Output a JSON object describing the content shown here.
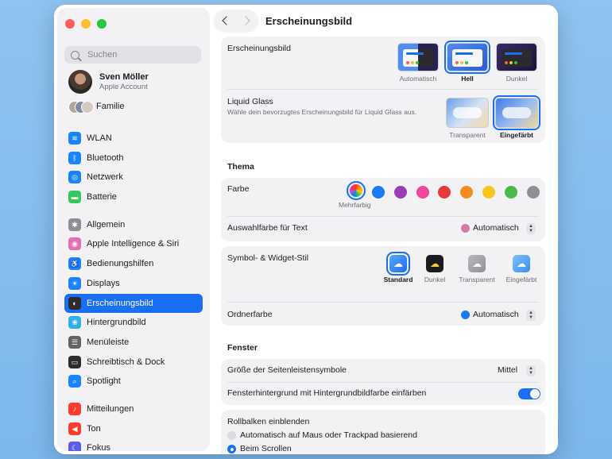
{
  "search": {
    "placeholder": "Suchen"
  },
  "account": {
    "name": "Sven Möller",
    "subtitle": "Apple Account"
  },
  "family": {
    "label": "Familie"
  },
  "sidebar": {
    "items": [
      {
        "label": "WLAN",
        "icon": "wifi-icon",
        "color": "#1a84ff"
      },
      {
        "label": "Bluetooth",
        "icon": "bluetooth-icon",
        "color": "#1a84ff"
      },
      {
        "label": "Netzwerk",
        "icon": "globe-icon",
        "color": "#1a84ff"
      },
      {
        "label": "Batterie",
        "icon": "battery-icon",
        "color": "#34c759"
      },
      {
        "label": "Allgemein",
        "icon": "gear-icon",
        "color": "#8e8e93"
      },
      {
        "label": "Apple Intelligence & Siri",
        "icon": "siri-icon",
        "color": "#e36fb0"
      },
      {
        "label": "Bedienungshilfen",
        "icon": "accessibility-icon",
        "color": "#1a84ff"
      },
      {
        "label": "Displays",
        "icon": "sun-icon",
        "color": "#1a84ff"
      },
      {
        "label": "Erscheinungsbild",
        "icon": "appearance-icon",
        "color": "#2c2c2e"
      },
      {
        "label": "Hintergrundbild",
        "icon": "flower-icon",
        "color": "#30b0e8"
      },
      {
        "label": "Menüleiste",
        "icon": "menubar-icon",
        "color": "#636366"
      },
      {
        "label": "Schreibtisch & Dock",
        "icon": "dock-icon",
        "color": "#2c2c2e"
      },
      {
        "label": "Spotlight",
        "icon": "magnifier-icon",
        "color": "#1a84ff"
      },
      {
        "label": "Mitteilungen",
        "icon": "bell-icon",
        "color": "#ff3b30"
      },
      {
        "label": "Ton",
        "icon": "speaker-icon",
        "color": "#ff3b30"
      },
      {
        "label": "Fokus",
        "icon": "moon-icon",
        "color": "#5e5ce6"
      }
    ]
  },
  "header": {
    "title": "Erscheinungsbild"
  },
  "appearance": {
    "label": "Erscheinungsbild",
    "options": [
      "Automatisch",
      "Hell",
      "Dunkel"
    ],
    "selected": "Hell"
  },
  "liquid_glass": {
    "label": "Liquid Glass",
    "description": "Wähle dein bevorzugtes Erscheinungsbild für Liquid Glass aus.",
    "options": [
      "Transparent",
      "Eingefärbt"
    ],
    "selected": "Eingefärbt"
  },
  "thema": {
    "heading": "Thema",
    "farbe_label": "Farbe",
    "selected_caption": "Mehrfarbig",
    "colors": [
      "#1a7bf5",
      "#9b3cb6",
      "#f0479a",
      "#e43b3b",
      "#f58a1f",
      "#f8c51c",
      "#4cb848",
      "#8e8e93"
    ],
    "highlight_label": "Auswahlfarbe für Text",
    "highlight_value": "Automatisch",
    "highlight_color": "#d27aa8"
  },
  "widgets": {
    "label": "Symbol- & Widget-Stil",
    "options": [
      "Standard",
      "Dunkel",
      "Transparent",
      "Eingefärbt"
    ],
    "selected": "Standard",
    "folder_label": "Ordnerfarbe",
    "folder_value": "Automatisch",
    "folder_color": "#1a7bf5"
  },
  "fenster": {
    "heading": "Fenster",
    "sidebar_size_label": "Größe der Seitenleistensymbole",
    "sidebar_size_value": "Mittel",
    "tint_label": "Fensterhintergrund mit Hintergrundbildfarbe einfärben",
    "tint_on": true
  },
  "scrollbars": {
    "label": "Rollbalken einblenden",
    "options": [
      "Automatisch auf Maus oder Trackpad basierend",
      "Beim Scrollen"
    ],
    "selected": "Beim Scrollen"
  }
}
